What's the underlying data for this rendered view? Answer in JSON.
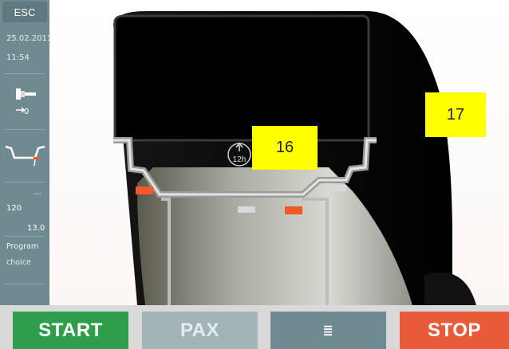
{
  "sidebar": {
    "esc_label": "ESC",
    "date": "25.02.2011",
    "time": "11:54",
    "balance_value": "0",
    "value_dashes": "---",
    "value_a": "120",
    "value_b": "13.0",
    "program_line1": "Program",
    "program_line2": "choice",
    "icons": [
      "balance-weight-icon",
      "rim-profile-icon"
    ]
  },
  "main": {
    "position_label": "12h",
    "callouts": [
      "16",
      "17"
    ]
  },
  "bottom": {
    "start_label": "START",
    "pax_label": "PAX",
    "list_icon": "≣",
    "stop_label": "STOP"
  },
  "colors": {
    "sidebar": "#6f8b91",
    "start": "#2e9e4a",
    "pax": "#a2b4b8",
    "stop": "#e85a3a",
    "marker": "#f05a28",
    "callout": "#ffff00"
  }
}
